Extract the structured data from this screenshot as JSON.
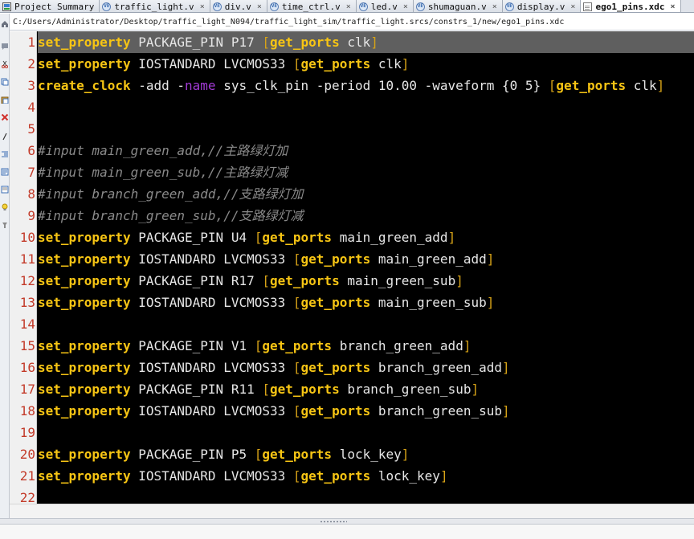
{
  "tabs": [
    {
      "label": "Project Summary",
      "icon": "summary-icon",
      "active": false
    },
    {
      "label": "traffic_light.v",
      "icon": "verilog-file-icon",
      "active": false
    },
    {
      "label": "div.v",
      "icon": "verilog-file-icon",
      "active": false
    },
    {
      "label": "time_ctrl.v",
      "icon": "verilog-file-icon",
      "active": false
    },
    {
      "label": "led.v",
      "icon": "verilog-file-icon",
      "active": false
    },
    {
      "label": "shumaguan.v",
      "icon": "verilog-file-icon",
      "active": false
    },
    {
      "label": "display.v",
      "icon": "verilog-file-icon",
      "active": false
    },
    {
      "label": "ego1_pins.xdc",
      "icon": "constraints-file-icon",
      "active": true
    }
  ],
  "path": "C:/Users/Administrator/Desktop/traffic_light_N094/traffic_light_sim/traffic_light.srcs/constrs_1/new/ego1_pins.xdc",
  "toolbar_icons": [
    "home-icon",
    "comment-icon",
    "cut-icon",
    "copy-icon",
    "paste-icon",
    "delete-icon",
    "toggle-comment-icon",
    "indent-icon",
    "outdent-icon",
    "insert-template-icon",
    "bulb-icon",
    "find-icon"
  ],
  "colors": {
    "editor_background": "#000000",
    "command": "#f7c514",
    "keyword": "#a13ad4",
    "comment": "#8a8a8a",
    "line_number": "#c33b2a",
    "current_line": "#5f5f5f"
  },
  "editor": {
    "current_line": 1,
    "lines": [
      {
        "n": "1",
        "tokens": [
          [
            "set_property",
            "cmd"
          ],
          [
            " PACKAGE_PIN P17 ",
            "txt"
          ],
          [
            "[",
            "br"
          ],
          [
            "get_ports",
            "key"
          ],
          [
            " clk",
            "txt"
          ],
          [
            "]",
            "br"
          ]
        ]
      },
      {
        "n": "2",
        "tokens": [
          [
            "set_property",
            "cmd"
          ],
          [
            " IOSTANDARD LVCMOS33 ",
            "txt"
          ],
          [
            "[",
            "br"
          ],
          [
            "get_ports",
            "key"
          ],
          [
            " clk",
            "txt"
          ],
          [
            "]",
            "br"
          ]
        ]
      },
      {
        "n": "3",
        "tokens": [
          [
            "create_clock",
            "cmd"
          ],
          [
            " -add -",
            "txt"
          ],
          [
            "name",
            "kw"
          ],
          [
            " sys_clk_pin -period 10.00 -waveform {0 5} ",
            "txt"
          ],
          [
            "[",
            "br"
          ],
          [
            "get_ports",
            "key"
          ],
          [
            " clk",
            "txt"
          ],
          [
            "]",
            "br"
          ]
        ]
      },
      {
        "n": "4",
        "tokens": []
      },
      {
        "n": "5",
        "tokens": []
      },
      {
        "n": "6",
        "tokens": [
          [
            "#input main_green_add,//主路绿灯加",
            "com"
          ]
        ]
      },
      {
        "n": "7",
        "tokens": [
          [
            "#input main_green_sub,//主路绿灯减",
            "com"
          ]
        ]
      },
      {
        "n": "8",
        "tokens": [
          [
            "#input branch_green_add,//支路绿灯加",
            "com"
          ]
        ]
      },
      {
        "n": "9",
        "tokens": [
          [
            "#input branch_green_sub,//支路绿灯减",
            "com"
          ]
        ]
      },
      {
        "n": "10",
        "tokens": [
          [
            "set_property",
            "cmd"
          ],
          [
            " PACKAGE_PIN U4 ",
            "txt"
          ],
          [
            "[",
            "br"
          ],
          [
            "get_ports",
            "key"
          ],
          [
            " main_green_add",
            "txt"
          ],
          [
            "]",
            "br"
          ]
        ]
      },
      {
        "n": "11",
        "tokens": [
          [
            "set_property",
            "cmd"
          ],
          [
            " IOSTANDARD LVCMOS33 ",
            "txt"
          ],
          [
            "[",
            "br"
          ],
          [
            "get_ports",
            "key"
          ],
          [
            " main_green_add",
            "txt"
          ],
          [
            "]",
            "br"
          ]
        ]
      },
      {
        "n": "12",
        "tokens": [
          [
            "set_property",
            "cmd"
          ],
          [
            " PACKAGE_PIN R17 ",
            "txt"
          ],
          [
            "[",
            "br"
          ],
          [
            "get_ports",
            "key"
          ],
          [
            " main_green_sub",
            "txt"
          ],
          [
            "]",
            "br"
          ]
        ]
      },
      {
        "n": "13",
        "tokens": [
          [
            "set_property",
            "cmd"
          ],
          [
            " IOSTANDARD LVCMOS33 ",
            "txt"
          ],
          [
            "[",
            "br"
          ],
          [
            "get_ports",
            "key"
          ],
          [
            " main_green_sub",
            "txt"
          ],
          [
            "]",
            "br"
          ]
        ]
      },
      {
        "n": "14",
        "tokens": []
      },
      {
        "n": "15",
        "tokens": [
          [
            "set_property",
            "cmd"
          ],
          [
            " PACKAGE_PIN V1 ",
            "txt"
          ],
          [
            "[",
            "br"
          ],
          [
            "get_ports",
            "key"
          ],
          [
            " branch_green_add",
            "txt"
          ],
          [
            "]",
            "br"
          ]
        ]
      },
      {
        "n": "16",
        "tokens": [
          [
            "set_property",
            "cmd"
          ],
          [
            " IOSTANDARD LVCMOS33 ",
            "txt"
          ],
          [
            "[",
            "br"
          ],
          [
            "get_ports",
            "key"
          ],
          [
            " branch_green_add",
            "txt"
          ],
          [
            "]",
            "br"
          ]
        ]
      },
      {
        "n": "17",
        "tokens": [
          [
            "set_property",
            "cmd"
          ],
          [
            " PACKAGE_PIN R11 ",
            "txt"
          ],
          [
            "[",
            "br"
          ],
          [
            "get_ports",
            "key"
          ],
          [
            " branch_green_sub",
            "txt"
          ],
          [
            "]",
            "br"
          ]
        ]
      },
      {
        "n": "18",
        "tokens": [
          [
            "set_property",
            "cmd"
          ],
          [
            " IOSTANDARD LVCMOS33 ",
            "txt"
          ],
          [
            "[",
            "br"
          ],
          [
            "get_ports",
            "key"
          ],
          [
            " branch_green_sub",
            "txt"
          ],
          [
            "]",
            "br"
          ]
        ]
      },
      {
        "n": "19",
        "tokens": []
      },
      {
        "n": "20",
        "tokens": [
          [
            "set_property",
            "cmd"
          ],
          [
            " PACKAGE_PIN P5 ",
            "txt"
          ],
          [
            "[",
            "br"
          ],
          [
            "get_ports",
            "key"
          ],
          [
            " lock_key",
            "txt"
          ],
          [
            "]",
            "br"
          ]
        ]
      },
      {
        "n": "21",
        "tokens": [
          [
            "set_property",
            "cmd"
          ],
          [
            " IOSTANDARD LVCMOS33 ",
            "txt"
          ],
          [
            "[",
            "br"
          ],
          [
            "get_ports",
            "key"
          ],
          [
            " lock_key",
            "txt"
          ],
          [
            "]",
            "br"
          ]
        ]
      },
      {
        "n": "22",
        "tokens": []
      }
    ]
  }
}
